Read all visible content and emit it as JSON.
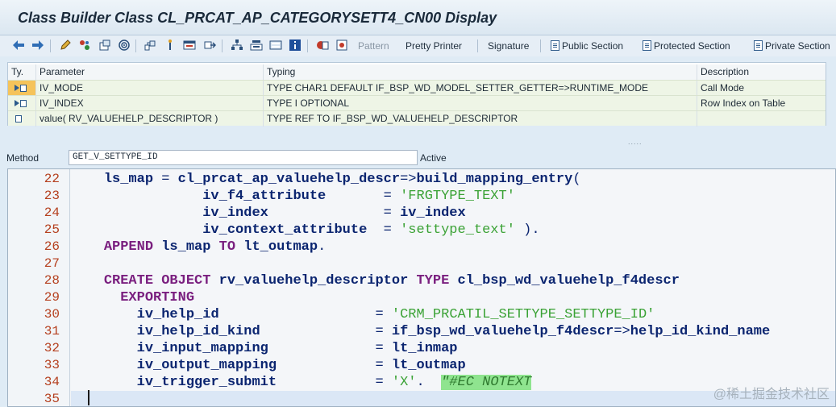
{
  "window": {
    "title": "Class Builder Class CL_PRCAT_AP_CATEGORYSETT4_CN00 Display"
  },
  "toolbar": {
    "icons": [
      "back-arrow-icon",
      "forward-arrow-icon",
      "edit-pencil-icon",
      "display-change-icon",
      "other-object-icon",
      "check-icon",
      "activate-icon",
      "where-used-icon",
      "test-icon",
      "object-list-icon",
      "navigation-window-icon",
      "display-object-list-icon",
      "info-icon",
      "help-icon",
      "enhance-icon"
    ],
    "pattern_label": "Pattern",
    "pretty_printer_label": "Pretty Printer",
    "signature_label": "Signature",
    "public_section_label": "Public Section",
    "protected_section_label": "Protected Section",
    "private_section_label": "Private Section"
  },
  "parameters": {
    "columns": [
      "Ty.",
      "Parameter",
      "Typing",
      "Description"
    ],
    "rows": [
      {
        "ty_icon": "importing-icon",
        "name": "IV_MODE",
        "typing": "TYPE CHAR1  DEFAULT IF_BSP_WD_MODEL_SETTER_GETTER=>RUNTIME_MODE",
        "description": "Call Mode"
      },
      {
        "ty_icon": "importing-icon",
        "name": "IV_INDEX",
        "typing": "TYPE I OPTIONAL",
        "description": "Row Index on Table"
      },
      {
        "ty_icon": "returning-icon",
        "name": "value( RV_VALUEHELP_DESCRIPTOR )",
        "typing": "TYPE REF TO IF_BSP_WD_VALUEHELP_DESCRIPTOR",
        "description": ""
      }
    ],
    "grip": "....."
  },
  "method": {
    "label": "Method",
    "name": "GET_V_SETTYPE_ID",
    "status": "Active"
  },
  "editor": {
    "lines": [
      {
        "no": "22",
        "segments": [
          {
            "t": "    ",
            "c": "op"
          },
          {
            "t": "ls_map",
            "c": "id"
          },
          {
            "t": " = ",
            "c": "op"
          },
          {
            "t": "cl_prcat_ap_valuehelp_descr",
            "c": "id"
          },
          {
            "t": "=>",
            "c": "op"
          },
          {
            "t": "build_mapping_entry",
            "c": "id"
          },
          {
            "t": "(",
            "c": "op"
          }
        ]
      },
      {
        "no": "23",
        "segments": [
          {
            "t": "                ",
            "c": "op"
          },
          {
            "t": "iv_f4_attribute",
            "c": "id"
          },
          {
            "t": "       = ",
            "c": "op"
          },
          {
            "t": "'FRGTYPE_TEXT'",
            "c": "str"
          }
        ]
      },
      {
        "no": "24",
        "segments": [
          {
            "t": "                ",
            "c": "op"
          },
          {
            "t": "iv_index",
            "c": "id"
          },
          {
            "t": "              = ",
            "c": "op"
          },
          {
            "t": "iv_index",
            "c": "id"
          }
        ]
      },
      {
        "no": "25",
        "segments": [
          {
            "t": "                ",
            "c": "op"
          },
          {
            "t": "iv_context_attribute",
            "c": "id"
          },
          {
            "t": "  = ",
            "c": "op"
          },
          {
            "t": "'settype_text'",
            "c": "str"
          },
          {
            "t": " ).",
            "c": "op"
          }
        ]
      },
      {
        "no": "26",
        "segments": [
          {
            "t": "    ",
            "c": "op"
          },
          {
            "t": "APPEND",
            "c": "kw"
          },
          {
            "t": " ",
            "c": "op"
          },
          {
            "t": "ls_map",
            "c": "id"
          },
          {
            "t": " ",
            "c": "op"
          },
          {
            "t": "TO",
            "c": "kw"
          },
          {
            "t": " ",
            "c": "op"
          },
          {
            "t": "lt_outmap",
            "c": "id"
          },
          {
            "t": ".",
            "c": "op"
          }
        ]
      },
      {
        "no": "27",
        "segments": []
      },
      {
        "no": "28",
        "segments": [
          {
            "t": "    ",
            "c": "op"
          },
          {
            "t": "CREATE OBJECT",
            "c": "kw"
          },
          {
            "t": " ",
            "c": "op"
          },
          {
            "t": "rv_valuehelp_descriptor",
            "c": "id"
          },
          {
            "t": " ",
            "c": "op"
          },
          {
            "t": "TYPE",
            "c": "kw"
          },
          {
            "t": " ",
            "c": "op"
          },
          {
            "t": "cl_bsp_wd_valuehelp_f4descr",
            "c": "id"
          }
        ]
      },
      {
        "no": "29",
        "segments": [
          {
            "t": "      ",
            "c": "op"
          },
          {
            "t": "EXPORTING",
            "c": "kw"
          }
        ]
      },
      {
        "no": "30",
        "segments": [
          {
            "t": "        ",
            "c": "op"
          },
          {
            "t": "iv_help_id",
            "c": "id"
          },
          {
            "t": "                   = ",
            "c": "op"
          },
          {
            "t": "'CRM_PRCATIL_SETTYPE_SETTYPE_ID'",
            "c": "str"
          }
        ]
      },
      {
        "no": "31",
        "segments": [
          {
            "t": "        ",
            "c": "op"
          },
          {
            "t": "iv_help_id_kind",
            "c": "id"
          },
          {
            "t": "              = ",
            "c": "op"
          },
          {
            "t": "if_bsp_wd_valuehelp_f4descr",
            "c": "id"
          },
          {
            "t": "=>",
            "c": "op"
          },
          {
            "t": "help_id_kind_name",
            "c": "id"
          }
        ]
      },
      {
        "no": "32",
        "segments": [
          {
            "t": "        ",
            "c": "op"
          },
          {
            "t": "iv_input_mapping",
            "c": "id"
          },
          {
            "t": "             = ",
            "c": "op"
          },
          {
            "t": "lt_inmap",
            "c": "id"
          }
        ]
      },
      {
        "no": "33",
        "segments": [
          {
            "t": "        ",
            "c": "op"
          },
          {
            "t": "iv_output_mapping",
            "c": "id"
          },
          {
            "t": "            = ",
            "c": "op"
          },
          {
            "t": "lt_outmap",
            "c": "id"
          }
        ]
      },
      {
        "no": "34",
        "segments": [
          {
            "t": "        ",
            "c": "op"
          },
          {
            "t": "iv_trigger_submit",
            "c": "id"
          },
          {
            "t": "            = ",
            "c": "op"
          },
          {
            "t": "'X'",
            "c": "str"
          },
          {
            "t": ".  ",
            "c": "op"
          },
          {
            "t": "\"#EC NOTEXT",
            "c": "cm"
          }
        ]
      },
      {
        "no": "35",
        "segments": []
      }
    ],
    "current_line": "35"
  },
  "watermark": "@稀土掘金技术社区"
}
